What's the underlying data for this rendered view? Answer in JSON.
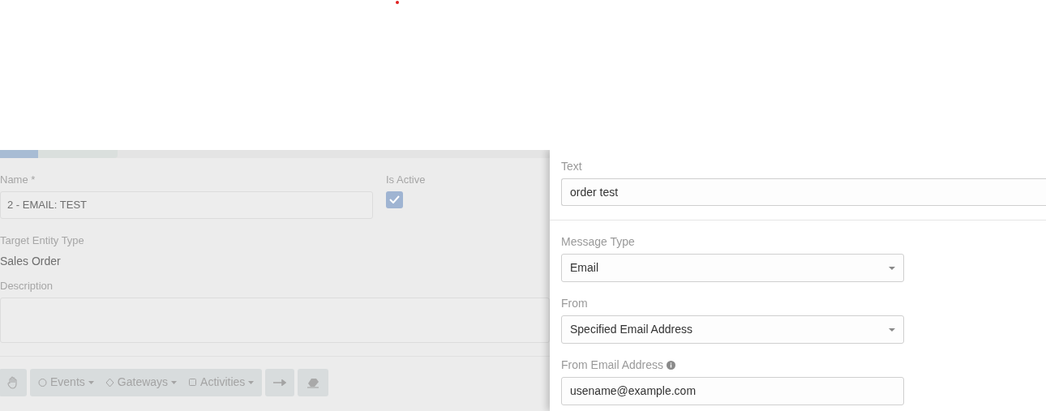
{
  "background_form": {
    "tabs": [
      {
        "selected": true
      },
      {
        "selected": false
      }
    ],
    "name": {
      "label": "Name *",
      "value": "2 - EMAIL: TEST"
    },
    "is_active": {
      "label": "Is Active",
      "checked": true
    },
    "target_entity_type": {
      "label": "Target Entity Type",
      "value": "Sales Order"
    },
    "description": {
      "label": "Description"
    },
    "toolbar": {
      "menus": [
        {
          "label": "Events",
          "kind": "circle"
        },
        {
          "label": "Gateways",
          "kind": "diamond"
        },
        {
          "label": "Activities",
          "kind": "square"
        }
      ]
    }
  },
  "panel": {
    "text": {
      "label": "Text",
      "value": "order test"
    },
    "message_type": {
      "label": "Message Type",
      "value": "Email"
    },
    "from": {
      "label": "From",
      "value": "Specified Email Address"
    },
    "from_email_address": {
      "label": "From Email Address",
      "value": "usename@example.com"
    }
  }
}
